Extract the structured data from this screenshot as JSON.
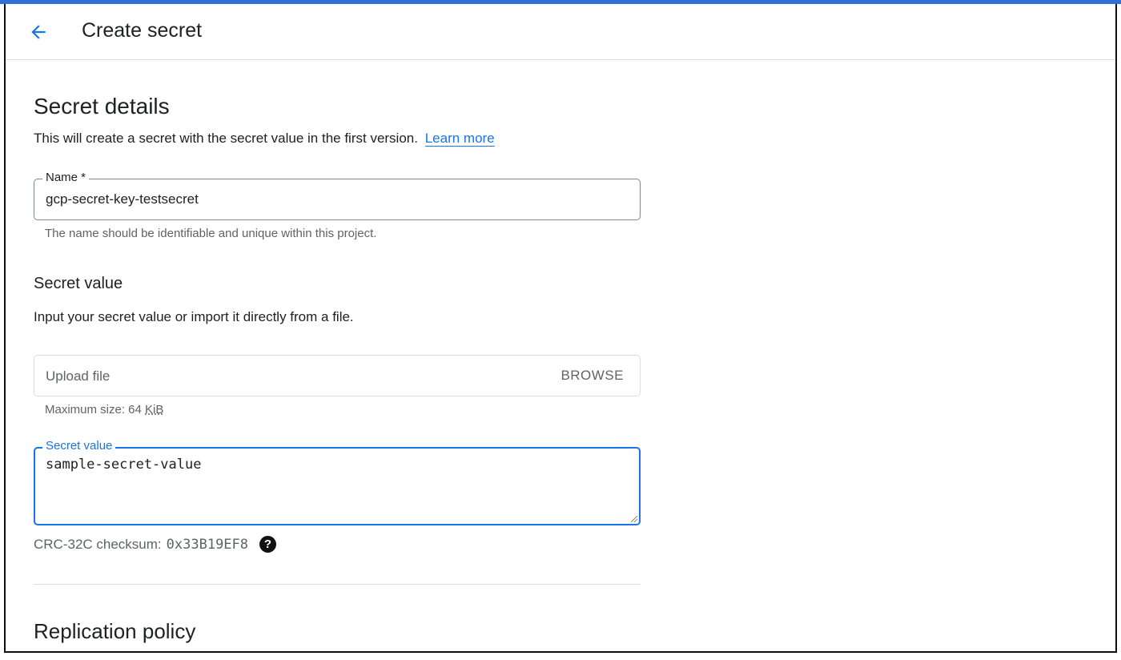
{
  "header": {
    "title": "Create secret",
    "back_icon": "arrow-back-icon",
    "accent_color": "#1a73e8"
  },
  "details": {
    "heading": "Secret details",
    "description": "This will create a secret with the secret value in the first version.",
    "learn_more": "Learn more"
  },
  "name_field": {
    "label": "Name *",
    "value": "gcp-secret-key-testsecret",
    "hint": "The name should be identifiable and unique within this project."
  },
  "secret_value_section": {
    "heading": "Secret value",
    "description": "Input your secret value or import it directly from a file.",
    "upload_placeholder": "Upload file",
    "browse_label": "BROWSE",
    "max_size_prefix": "Maximum size: 64 ",
    "max_size_unit": "KiB",
    "field_label": "Secret value",
    "field_value": "sample-secret-value",
    "checksum_label": "CRC-32C checksum:",
    "checksum_value": "0x33B19EF8",
    "help_icon": "help-icon"
  },
  "replication": {
    "heading": "Replication policy"
  }
}
